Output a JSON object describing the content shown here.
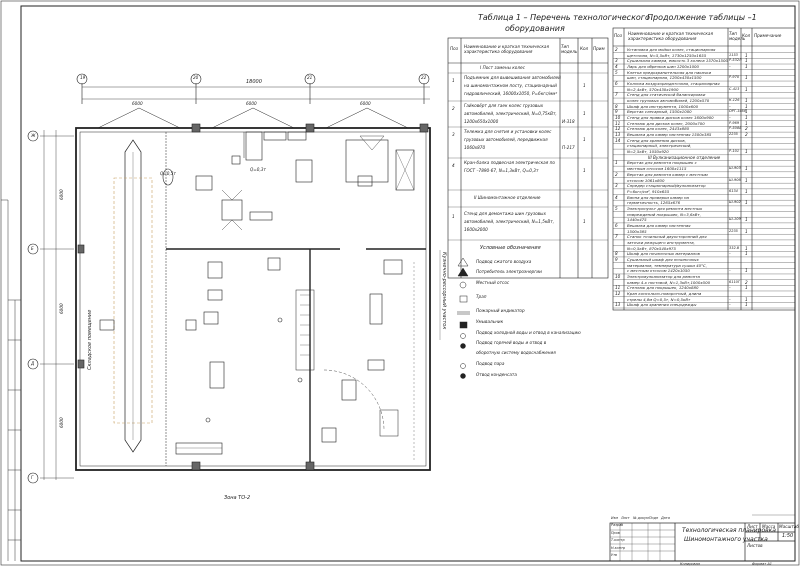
{
  "table1": {
    "title_line1": "Таблица 1 – Перечень технологического",
    "title_line2": "оборудования",
    "headers": [
      "Поз",
      "Наименование и краткая техническая характеристика оборудования",
      "Тип модель",
      "Кол",
      "Прим"
    ],
    "section1": "I Пост замены колес",
    "rows": [
      {
        "pos": "1",
        "name1": "Подъемник для вывешивания автомобилей",
        "name2": "на шиномонтажном посту, стационарный",
        "name3": "гидравлический, 16000х1050, Р=6кгс/мм²",
        "model": "",
        "qty": "1"
      },
      {
        "pos": "2",
        "name1": "Гайковёрт для гаек колес грузовых",
        "name2": "автомобилей, электрический, N=0,75кВт,",
        "name3": "1200х650х1000",
        "model": "И-318",
        "qty": "1"
      },
      {
        "pos": "3",
        "name1": "Тележка для снятия и установки колес",
        "name2": "грузовых автомобилей, передвижная",
        "name3": "1060х870",
        "model": "П-217",
        "qty": "1"
      },
      {
        "pos": "4",
        "name1": "Кран-балка подвесная электрическая по",
        "name2": "ГОСТ –7890-67, N=1,3кВт, Q=0,3т",
        "name3": "",
        "model": "",
        "qty": "1"
      }
    ],
    "section2": "II Шиномонтажное отделение",
    "rows2": [
      {
        "pos": "1",
        "name1": "Стенд для демонтажа шин грузовых",
        "name2": "автомобилей, электрический, N=1,5кВт,",
        "name3": "1600х2000",
        "model": "",
        "qty": "1"
      }
    ]
  },
  "table2": {
    "title": "Продолжение таблицы –1",
    "headers": [
      "Поз",
      "Наименование и краткая техническая характеристика оборудования",
      "Тип модель",
      "Кол",
      "Примечание"
    ],
    "rows": [
      {
        "pos": "2",
        "name": "Установка для мойки колес, стационарная",
        "model": "",
        "qty": ""
      },
      {
        "pos": "",
        "name": "щеточная, N=5,5кВт, 1730х1250х1655",
        "model": "1153",
        "qty": "1"
      },
      {
        "pos": "3",
        "name": "Сушильная камера, емкость 3 колеса 1570х1500",
        "model": "Р-532Л",
        "qty": "1"
      },
      {
        "pos": "4",
        "name": "Ларь для обрезков шин 1200х1000",
        "model": "–",
        "qty": "1"
      },
      {
        "pos": "5",
        "name": "Клетка предохранительная для накачки",
        "model": "",
        "qty": ""
      },
      {
        "pos": "",
        "name": "шин, стационарная, 1200х430х1500",
        "model": "Р-970",
        "qty": "1"
      },
      {
        "pos": "6",
        "name": "Колонка воздухораздаточная, стационарная",
        "model": "",
        "qty": ""
      },
      {
        "pos": "",
        "name": "N=2,4кВт, 570х430х1900",
        "model": "С-413",
        "qty": "1"
      },
      {
        "pos": "7",
        "name": "Стенд для статической балансировки",
        "model": "",
        "qty": ""
      },
      {
        "pos": "",
        "name": "колес грузовых автомобилей, 1200х570",
        "model": "К-126",
        "qty": "1"
      },
      {
        "pos": "8",
        "name": "Шкаф для инструмента, 1000х600",
        "model": "–",
        "qty": "1"
      },
      {
        "pos": "9",
        "name": "Верстак слесарный, 1500х1000",
        "model": "ОРГ-1468",
        "qty": "1"
      },
      {
        "pos": "10",
        "name": "Стенд для правки дисков колес 1600х900",
        "model": "–",
        "qty": "1"
      },
      {
        "pos": "11",
        "name": "Стеллаж для дисков колес, 2000х700",
        "model": "Р-969",
        "qty": "1"
      },
      {
        "pos": "12",
        "name": "Стеллаж для колес, 2443х880",
        "model": "Р-508А",
        "qty": "2"
      },
      {
        "pos": "13",
        "name": "Вешалка для камер настенная 1500х385",
        "model": "2235",
        "qty": "2"
      },
      {
        "pos": "14",
        "name": "Стенд для хранения дисков,",
        "model": "",
        "qty": ""
      },
      {
        "pos": "",
        "name": "стационарный, электрический,",
        "model": "",
        "qty": ""
      },
      {
        "pos": "",
        "name": "N=2,5кВт, 1050х920",
        "model": "Р-101",
        "qty": "1"
      }
    ],
    "section3": "III Вулканизационное отделение",
    "rows3": [
      {
        "pos": "1",
        "name": "Верстак для ремонта покрышек с",
        "model": "",
        "qty": ""
      },
      {
        "pos": "",
        "name": "местным отсосом 1600х1115",
        "model": "Ш-903",
        "qty": "1"
      },
      {
        "pos": "2",
        "name": "Верстак для ремонта камер с местным",
        "model": "",
        "qty": ""
      },
      {
        "pos": "",
        "name": "отсосом 1061х800",
        "model": "Ш-906",
        "qty": "1"
      },
      {
        "pos": "3",
        "name": "Спредер стационарный/вулканизатор",
        "model": "",
        "qty": ""
      },
      {
        "pos": "",
        "name": "Р=6кгс/см², 910х655",
        "model": "6134",
        "qty": "1"
      },
      {
        "pos": "4",
        "name": "Ванна для проверки камер на",
        "model": "",
        "qty": ""
      },
      {
        "pos": "",
        "name": "герметичность, 1265х676",
        "model": "Ш-902",
        "qty": "1"
      },
      {
        "pos": "5",
        "name": "Электропульт для ремонта местных",
        "model": "",
        "qty": ""
      },
      {
        "pos": "",
        "name": "повреждений покрышек, N=3,6кВт,",
        "model": "",
        "qty": ""
      },
      {
        "pos": "",
        "name": "1440х475",
        "model": "Ш-109",
        "qty": "1"
      },
      {
        "pos": "6",
        "name": "Вешалка для камер настенная",
        "model": "",
        "qty": ""
      },
      {
        "pos": "",
        "name": "1500х385",
        "model": "2235",
        "qty": "1"
      },
      {
        "pos": "7",
        "name": "Станок точильный двухсторонний для",
        "model": "",
        "qty": ""
      },
      {
        "pos": "",
        "name": "заточки режущего инструмента,",
        "model": "",
        "qty": ""
      },
      {
        "pos": "",
        "name": "N=0,5кВт, 870х540х975",
        "model": "332-б",
        "qty": "1"
      },
      {
        "pos": "8",
        "name": "Шкаф для починочных материалов",
        "model": "–",
        "qty": "1"
      },
      {
        "pos": "9",
        "name": "Сушильный шкаф для починочных",
        "model": "",
        "qty": ""
      },
      {
        "pos": "",
        "name": "материалов, температура сушки 40°С,",
        "model": "",
        "qty": ""
      },
      {
        "pos": "",
        "name": "с местным отсосом 1420х1050",
        "model": "–",
        "qty": "1"
      },
      {
        "pos": "10",
        "name": "Электровулканизатор для ремонта",
        "model": "",
        "qty": ""
      },
      {
        "pos": "",
        "name": "камер 4-х постовой, N=1,3кВт,1000х500",
        "model": "6110Г",
        "qty": "2"
      },
      {
        "pos": "11",
        "name": "Стеллаж для покрышек, 1240х880",
        "model": "–",
        "qty": "1"
      },
      {
        "pos": "12",
        "name": "Кран консольно-поворотный, длина",
        "model": "",
        "qty": ""
      },
      {
        "pos": "",
        "name": "стрелы 4,8м Q=0,5т, N=0,5кВт",
        "model": "–",
        "qty": "1"
      },
      {
        "pos": "13",
        "name": "Шкаф для хранения спецодежды",
        "model": "–",
        "qty": "1"
      }
    ]
  },
  "legend": {
    "title": "Условные обозначения",
    "items": [
      "Подвод сжатого воздуха",
      "Потребитель электроэнергии",
      "Местный отсос",
      "Трап",
      "Пожарный индикатор",
      "Умывальник",
      "Подвод холодной воды и отвод в канализацию",
      "Подвод горячей воды и отвод в",
      "оборотную систему водоснабжения",
      "Подвод пара",
      "Отвод конденсата"
    ]
  },
  "plan": {
    "axes_top": [
      "19",
      "20",
      "21",
      "22"
    ],
    "axes_left": [
      "Ж",
      "Е",
      "Д",
      "Г"
    ],
    "dim_total": "18000",
    "dims_top": [
      "6000",
      "6000",
      "6000"
    ],
    "dims_left": [
      "6000",
      "6000",
      "6000"
    ],
    "label_zone": "Зона ТО-2",
    "label_left": "Складское помещение",
    "label_right": "Кузнечно-рессорный участок",
    "label_crane": "Q=0,5т",
    "label_beam": "Q=0,3т"
  },
  "stamp": {
    "title_line1": "Технологическая планировка",
    "title_line2": "Шиномонтажного участка",
    "sheet_label": "Лист",
    "sheets_label": "Листов",
    "mass_label": "Масса",
    "scale_label": "Масштаб",
    "scale_value": "1:50",
    "copied_label": "Копировал",
    "format_label": "Формат А1",
    "roles": [
      "Разраб",
      "Пров",
      "Т.контр",
      "Н.контр",
      "Утв"
    ],
    "cols": [
      "Изм",
      "Лист",
      "№ докум",
      "Подп",
      "Дата"
    ]
  },
  "colors": {
    "lines": "#222222",
    "accent": "#c8a060"
  }
}
